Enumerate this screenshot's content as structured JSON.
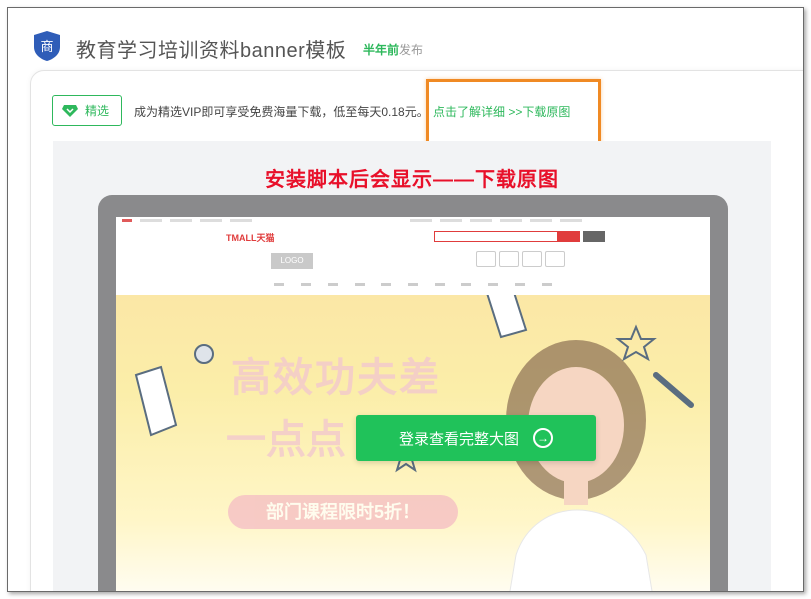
{
  "header": {
    "badge_char": "商",
    "title": "教育学习培训资料banner模板",
    "time_highlight": "半年前",
    "time_suffix": "发布"
  },
  "vip": {
    "tag_label": "精选",
    "text": "成为精选VIP即可享受免费海量下载，低至每天0.18元。",
    "link": "点击了解详细 >>下载原图"
  },
  "preview": {
    "overlay_title": "安装脚本后会显示——下载原图",
    "tmall_logo": "TMALL天猫",
    "logo_placeholder": "LOGO",
    "hero_line1": "高效功夫差",
    "hero_line2": "一点点",
    "hero_pill": "部门课程限时5折！",
    "login_button": "登录查看完整大图",
    "login_arrow": "→"
  },
  "colors": {
    "accent_green": "#2eb85c",
    "button_green": "#20c25a",
    "highlight_orange": "#f08a24",
    "overlay_red": "#e8102a",
    "badge_blue": "#2f5db8"
  }
}
